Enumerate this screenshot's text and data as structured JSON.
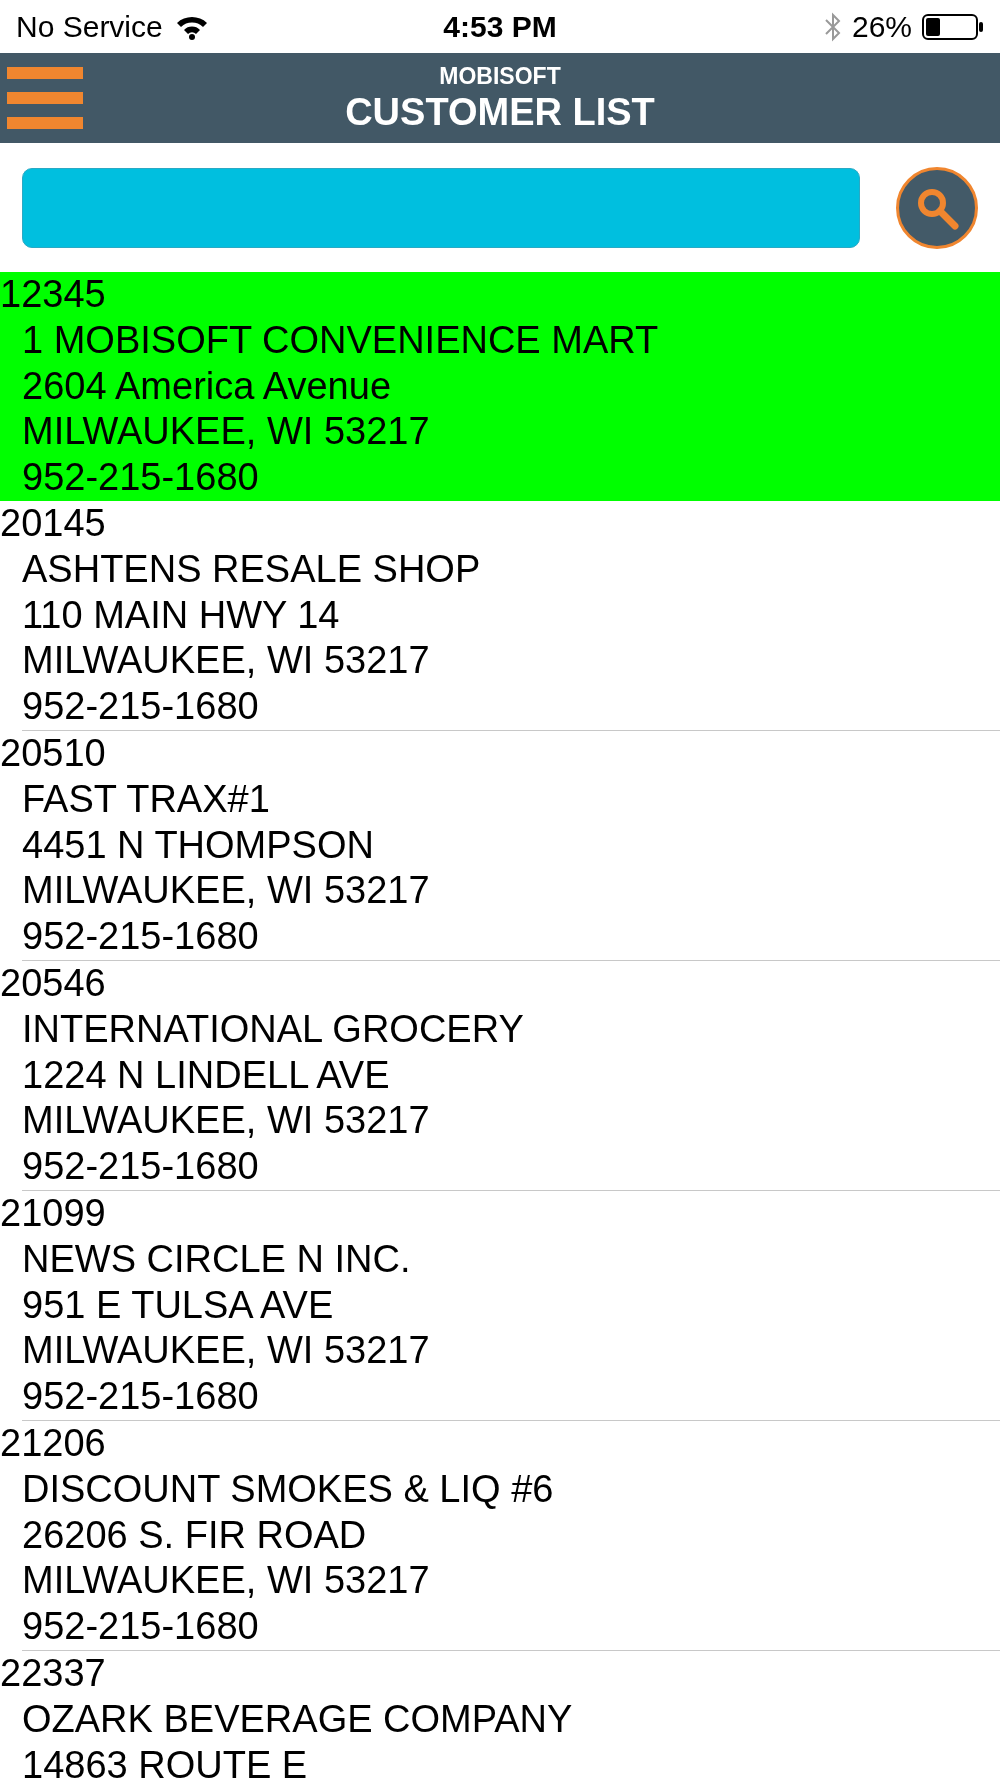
{
  "status_bar": {
    "carrier": "No Service",
    "time": "4:53 PM",
    "battery": "26%"
  },
  "header": {
    "app_name": "MOBISOFT",
    "title": "CUSTOMER LIST"
  },
  "customers": [
    {
      "id": "12345",
      "name": "1 MOBISOFT CONVENIENCE MART",
      "street": "2604 America Avenue",
      "city": "MILWAUKEE, WI 53217",
      "phone": "952-215-1680",
      "selected": true
    },
    {
      "id": "20145",
      "name": "ASHTENS RESALE SHOP",
      "street": "110 MAIN HWY 14",
      "city": "MILWAUKEE, WI 53217",
      "phone": "952-215-1680",
      "selected": false
    },
    {
      "id": "20510",
      "name": "FAST TRAX#1",
      "street": "4451 N THOMPSON",
      "city": "MILWAUKEE, WI 53217",
      "phone": "952-215-1680",
      "selected": false
    },
    {
      "id": "20546",
      "name": "INTERNATIONAL GROCERY",
      "street": "1224 N LINDELL AVE",
      "city": "MILWAUKEE, WI 53217",
      "phone": "952-215-1680",
      "selected": false
    },
    {
      "id": "21099",
      "name": "NEWS CIRCLE N INC.",
      "street": "951 E TULSA AVE",
      "city": "MILWAUKEE, WI 53217",
      "phone": "952-215-1680",
      "selected": false
    },
    {
      "id": "21206",
      "name": "DISCOUNT SMOKES & LIQ #6",
      "street": "26206 S. FIR ROAD",
      "city": "MILWAUKEE, WI 53217",
      "phone": "952-215-1680",
      "selected": false
    },
    {
      "id": "22337",
      "name": "OZARK BEVERAGE COMPANY",
      "street": "14863 ROUTE E",
      "selected": false
    }
  ]
}
